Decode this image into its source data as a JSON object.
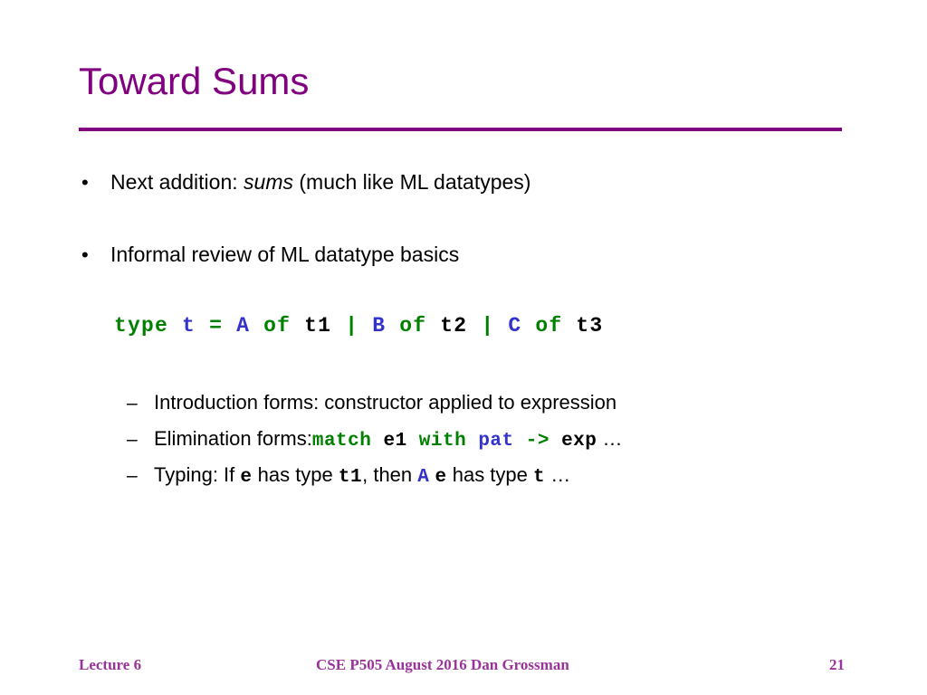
{
  "slide": {
    "title": "Toward Sums",
    "accent_color": "#800080",
    "background_color": "#ffffff"
  },
  "bullets": [
    {
      "marker": "•",
      "parts": [
        {
          "text": "Next addition: ",
          "style": "plain"
        },
        {
          "text": "sums",
          "style": "italic"
        },
        {
          "text": " (much like ML datatypes)",
          "style": "plain"
        }
      ],
      "plain": "Next addition: sums (much like ML datatypes)"
    },
    {
      "marker": "•",
      "parts": [
        {
          "text": "Informal review of ML datatype basics",
          "style": "plain"
        }
      ],
      "plain": "Informal review of ML datatype basics"
    }
  ],
  "code_block": {
    "plain": "type t = A of t1 | B of t2 | C of t3",
    "tokens": [
      {
        "text": "type",
        "color": "#008000",
        "kind": "keyword"
      },
      {
        "text": " ",
        "color": "#000000",
        "kind": "space"
      },
      {
        "text": "t",
        "color": "#3333cc",
        "kind": "variable"
      },
      {
        "text": " ",
        "color": "#000000",
        "kind": "space"
      },
      {
        "text": "=",
        "color": "#008000",
        "kind": "operator"
      },
      {
        "text": " ",
        "color": "#000000",
        "kind": "space"
      },
      {
        "text": "A",
        "color": "#3333cc",
        "kind": "constructor"
      },
      {
        "text": " ",
        "color": "#000000",
        "kind": "space"
      },
      {
        "text": "of",
        "color": "#008000",
        "kind": "keyword"
      },
      {
        "text": " ",
        "color": "#000000",
        "kind": "space"
      },
      {
        "text": "t1",
        "color": "#000000",
        "kind": "type"
      },
      {
        "text": " ",
        "color": "#000000",
        "kind": "space"
      },
      {
        "text": "|",
        "color": "#008000",
        "kind": "operator"
      },
      {
        "text": " ",
        "color": "#000000",
        "kind": "space"
      },
      {
        "text": "B",
        "color": "#3333cc",
        "kind": "constructor"
      },
      {
        "text": " ",
        "color": "#000000",
        "kind": "space"
      },
      {
        "text": "of",
        "color": "#008000",
        "kind": "keyword"
      },
      {
        "text": " ",
        "color": "#000000",
        "kind": "space"
      },
      {
        "text": "t2",
        "color": "#000000",
        "kind": "type"
      },
      {
        "text": " ",
        "color": "#000000",
        "kind": "space"
      },
      {
        "text": "|",
        "color": "#008000",
        "kind": "operator"
      },
      {
        "text": " ",
        "color": "#000000",
        "kind": "space"
      },
      {
        "text": "C",
        "color": "#3333cc",
        "kind": "constructor"
      },
      {
        "text": " ",
        "color": "#000000",
        "kind": "space"
      },
      {
        "text": "of",
        "color": "#008000",
        "kind": "keyword"
      },
      {
        "text": " ",
        "color": "#000000",
        "kind": "space"
      },
      {
        "text": "t3",
        "color": "#000000",
        "kind": "type"
      }
    ]
  },
  "sub_bullets": [
    {
      "marker": "–",
      "plain": "Introduction forms: constructor applied to expression",
      "parts": [
        {
          "text": "Introduction forms: constructor applied to expression",
          "style": "plain"
        }
      ]
    },
    {
      "marker": "–",
      "plain": "Elimination forms: match e1 with pat -> exp …",
      "parts": [
        {
          "text": "Elimination forms:",
          "style": "plain"
        },
        {
          "text": "match",
          "style": "mono",
          "color": "#008000"
        },
        {
          "text": " ",
          "style": "mono",
          "color": "#000000"
        },
        {
          "text": "e1",
          "style": "mono",
          "color": "#000000"
        },
        {
          "text": " ",
          "style": "mono",
          "color": "#000000"
        },
        {
          "text": "with",
          "style": "mono",
          "color": "#008000"
        },
        {
          "text": " ",
          "style": "mono",
          "color": "#000000"
        },
        {
          "text": "pat",
          "style": "mono",
          "color": "#3333cc"
        },
        {
          "text": " ",
          "style": "mono",
          "color": "#000000"
        },
        {
          "text": "->",
          "style": "mono",
          "color": "#008000"
        },
        {
          "text": " ",
          "style": "mono",
          "color": "#000000"
        },
        {
          "text": "exp",
          "style": "mono",
          "color": "#000000"
        },
        {
          "text": " …",
          "style": "plain"
        }
      ]
    },
    {
      "marker": "–",
      "plain": "Typing: If e has type t1, then A e has type t …",
      "parts": [
        {
          "text": "Typing: If ",
          "style": "plain"
        },
        {
          "text": "e",
          "style": "mono",
          "color": "#000000"
        },
        {
          "text": " has type ",
          "style": "plain"
        },
        {
          "text": "t1",
          "style": "mono",
          "color": "#000000"
        },
        {
          "text": ", then ",
          "style": "plain"
        },
        {
          "text": "A",
          "style": "mono",
          "color": "#3333cc"
        },
        {
          "text": " ",
          "style": "plain"
        },
        {
          "text": "e",
          "style": "mono",
          "color": "#000000"
        },
        {
          "text": " has type ",
          "style": "plain"
        },
        {
          "text": "t",
          "style": "mono",
          "color": "#000000"
        },
        {
          "text": " …",
          "style": "plain"
        }
      ]
    }
  ],
  "footer": {
    "left": "Lecture 6",
    "center": "CSE P505 August 2016  Dan Grossman",
    "right": "21",
    "color": "#993399"
  }
}
